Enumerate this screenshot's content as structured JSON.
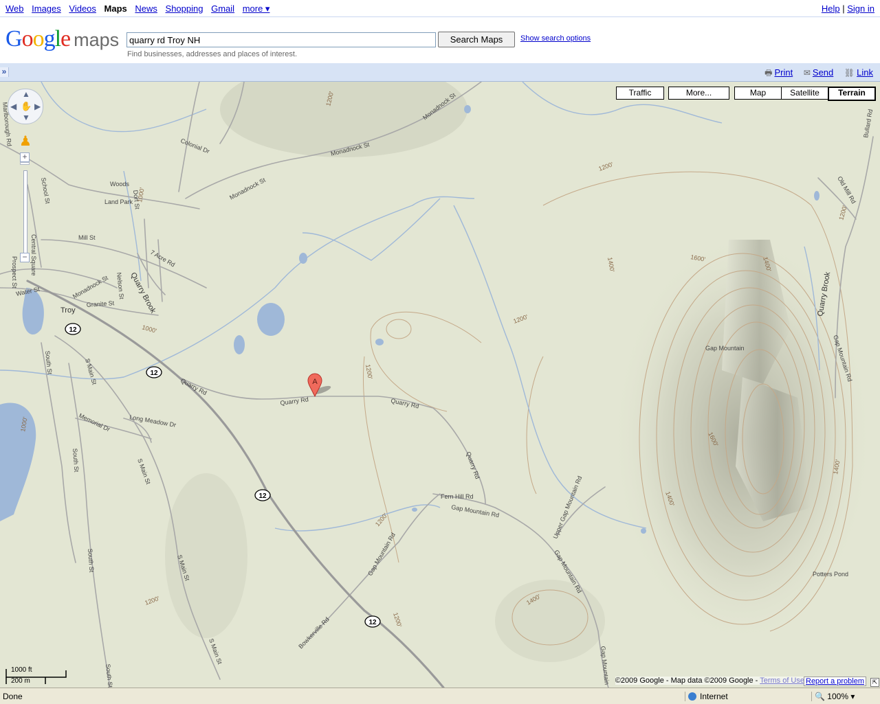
{
  "topnav": {
    "links": [
      "Web",
      "Images",
      "Videos",
      "Maps",
      "News",
      "Shopping",
      "Gmail",
      "more ▾"
    ],
    "active": "Maps",
    "help": "Help",
    "sign_in": "Sign in",
    "separator": "|"
  },
  "header": {
    "logo_text": "Google",
    "logo_sub": "maps",
    "search_value": "quarry rd Troy NH",
    "search_button": "Search Maps",
    "show_options": "Show search options",
    "hint": "Find businesses, addresses and places of interest."
  },
  "toolbar": {
    "collapse": "»",
    "print": "Print",
    "send": "Send",
    "link": "Link"
  },
  "map": {
    "map_types": [
      "Traffic",
      "More...",
      "Map",
      "Satellite",
      "Terrain"
    ],
    "selected_type": "Terrain",
    "marker_label": "A",
    "colors": {
      "water": "#9fb8d8",
      "road": "#a8a8a8",
      "highway": "#999999",
      "contour": "#b89a78",
      "land": "#e3e6d3"
    },
    "labels": {
      "troy": "Troy",
      "quarry_brook_w": "Quarry Brook",
      "quarry_brook_e": "Quarry Brook",
      "gap_mountain": "Gap Mountain",
      "potters_pond": "Potters Pond",
      "quarry_rd_1": "Quarry Rd",
      "quarry_rd_2": "Quarry Rd",
      "quarry_rd_3": "Quarry Rd",
      "quarry_rd_4": "Quarry Rd",
      "monadnock_st_1": "Monadnock St",
      "monadnock_st_2": "Monadnock St",
      "monadnock_st_3": "Monadnock St",
      "monadnock_st_4": "Monadnock St",
      "colonial_dr": "Colonial Dr",
      "school_st": "School St",
      "mill_st": "Mill St",
      "water_st": "Water St",
      "granite_st": "Granite St",
      "central_sq": "Central Square",
      "prospect_st": "Prospect St",
      "marlborough_rd": "Marlborough Rd",
      "dort_st": "Dort St",
      "acre_rd": "7 Acre Rd",
      "nelson_st": "Nelson St",
      "woods_park": "Woods",
      "land_park": "Land Park",
      "south_st_1": "South St",
      "south_st_2": "South St",
      "south_st_3": "South St",
      "south_st_4": "South St",
      "s_main_st_1": "S Main St",
      "s_main_st_2": "S Main St",
      "s_main_st_3": "S Main St",
      "s_main_st_4": "S Main St",
      "memorial_dr": "Memorial Dr",
      "long_meadow": "Long Meadow Dr",
      "fern_hill_rd": "Fern Hill Rd",
      "gap_mountain_rd_1": "Gap Mountain Rd",
      "gap_mountain_rd_2": "Gap Mountain Rd",
      "gap_mountain_rd_3": "Gap Mountain Rd",
      "gap_mountain_rd_4": "Gap Mountain Rd",
      "gap_mountain_rd_5": "Gap Mountain",
      "upper_gap": "Upper Gap Mountain Rd",
      "bowkerville_rd": "Bowkerville Rd",
      "old_mill_rd": "Old Mill Rd",
      "bullard_rd": "Bullard Rd",
      "route_12": "12"
    },
    "elevations": {
      "e1200_a": "1200'",
      "e1200_b": "1200'",
      "e1200_c": "1200'",
      "e1200_d": "1200'",
      "e1200_e": "1200'",
      "e1200_f": "1200'",
      "e1200_g": "1200'",
      "e1200_h": "1200'",
      "e1400_a": "1400'",
      "e1400_b": "1400'",
      "e1400_c": "1400'",
      "e1400_d": "1400'",
      "e1400_e": "1400'",
      "e1600_a": "1600'",
      "e1600_b": "1600'",
      "e1000_a": "1000'",
      "e1000_b": "1000'",
      "e1000_c": "1000'"
    },
    "scale_ft": "1000 ft",
    "scale_m": "200 m",
    "copyright": "©2009 Google - Map data ©2009 Google -",
    "terms": "Terms of Use",
    "report": "Report a problem"
  },
  "statusbar": {
    "status": "Done",
    "zone": "Internet",
    "zoom": "100%"
  }
}
